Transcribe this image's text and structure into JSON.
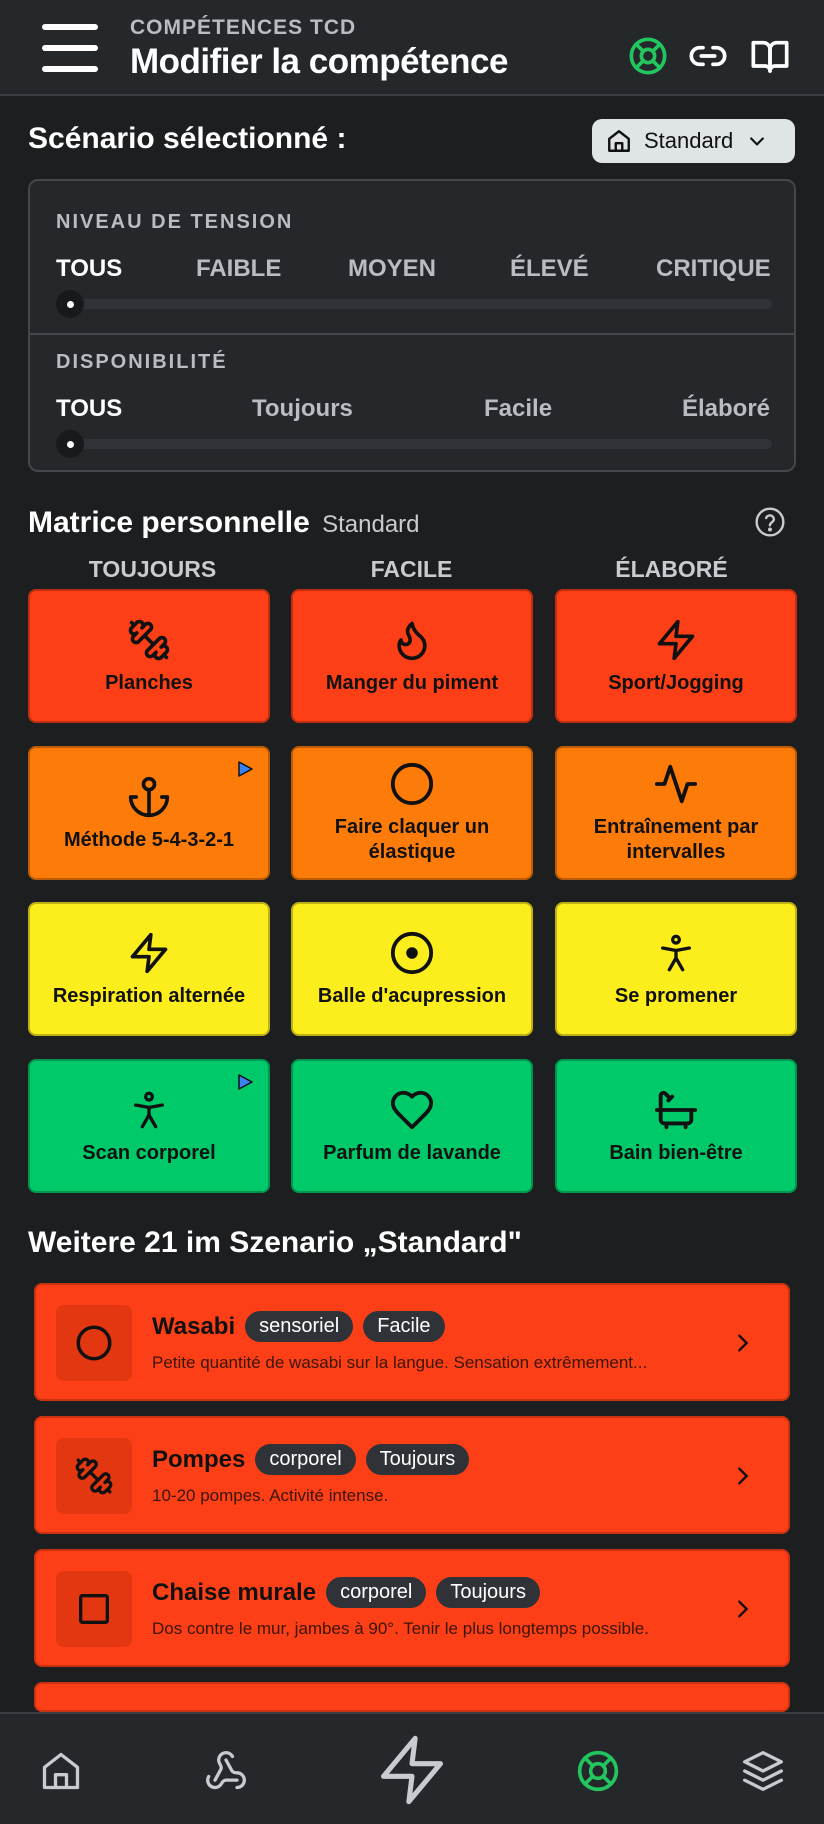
{
  "header": {
    "subtitle": "COMPÉTENCES TCD",
    "title": "Modifier la compétence",
    "icons": [
      "menu-icon",
      "lifebuoy-icon",
      "link-icon",
      "book-open-icon"
    ]
  },
  "scenario": {
    "label": "Scénario sélectionné :",
    "selected": "Standard",
    "icon": "home-icon"
  },
  "filters": {
    "tension": {
      "heading": "NIVEAU DE TENSION",
      "options": [
        "TOUS",
        "FAIBLE",
        "MOYEN",
        "ÉLEVÉ",
        "CRITIQUE"
      ],
      "selected": "TOUS"
    },
    "availability": {
      "heading": "DISPONIBILITÉ",
      "options": [
        "TOUS",
        "Toujours",
        "Facile",
        "Élaboré"
      ],
      "selected": "TOUS"
    }
  },
  "matrix": {
    "title": "Matrice personnelle",
    "subtitle": "Standard",
    "columns": [
      "TOUJOURS",
      "FACILE",
      "ÉLABORÉ"
    ],
    "tiles": [
      {
        "label": "Planches",
        "icon": "dumbbell-icon",
        "level": "red"
      },
      {
        "label": "Manger du piment",
        "icon": "flame-icon",
        "level": "red"
      },
      {
        "label": "Sport/Jogging",
        "icon": "lightning-icon",
        "level": "red"
      },
      {
        "label": "Méthode 5-4-3-2-1",
        "icon": "anchor-icon",
        "level": "orange",
        "play": true
      },
      {
        "label": "Faire claquer un élastique",
        "icon": "circle-icon",
        "level": "orange"
      },
      {
        "label": "Entraînement par intervalles",
        "icon": "activity-icon",
        "level": "orange"
      },
      {
        "label": "Respiration alternée",
        "icon": "lightning-icon",
        "level": "yellow"
      },
      {
        "label": "Balle d'acupression",
        "icon": "target-icon",
        "level": "yellow"
      },
      {
        "label": "Se promener",
        "icon": "person-icon",
        "level": "yellow"
      },
      {
        "label": "Scan corporel",
        "icon": "person-icon",
        "level": "green",
        "play": true
      },
      {
        "label": "Parfum de lavande",
        "icon": "heart-icon",
        "level": "green"
      },
      {
        "label": "Bain bien-être",
        "icon": "bath-icon",
        "level": "green"
      }
    ],
    "colors": {
      "red": "#fc3f16",
      "orange": "#fd7b09",
      "yellow": "#fced1c",
      "green": "#00c96a"
    }
  },
  "more": {
    "title": "Weitere 21 im Szenario „Standard\"",
    "items": [
      {
        "name": "Wasabi",
        "tags": [
          "sensoriel",
          "Facile"
        ],
        "description": "Petite quantité de wasabi sur la langue. Sensation extrêmement...",
        "icon": "circle-icon"
      },
      {
        "name": "Pompes",
        "tags": [
          "corporel",
          "Toujours"
        ],
        "description": "10-20 pompes. Activité intense.",
        "icon": "dumbbell-icon"
      },
      {
        "name": "Chaise murale",
        "tags": [
          "corporel",
          "Toujours"
        ],
        "description": "Dos contre le mur, jambes à 90°. Tenir le plus longtemps possible.",
        "icon": "square-icon"
      }
    ]
  },
  "nav": {
    "items": [
      "home-icon",
      "webhook-icon",
      "lightning-icon",
      "lifebuoy-icon",
      "layers-icon"
    ],
    "active": "lifebuoy-icon"
  }
}
